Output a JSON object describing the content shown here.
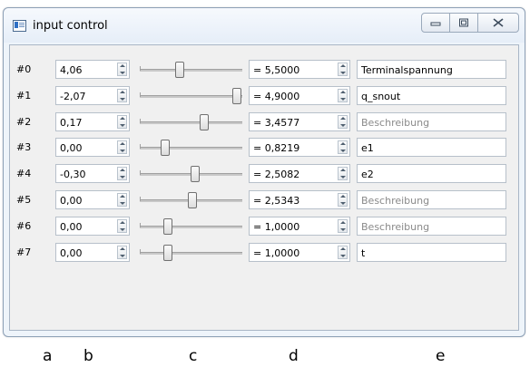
{
  "window": {
    "title": "input control"
  },
  "rows": [
    {
      "index": "#0",
      "number": "4,06",
      "slider_fraction": 0.38,
      "value": "= 5,5000",
      "description": "Terminalspannung",
      "placeholder": false
    },
    {
      "index": "#1",
      "number": "-2,07",
      "slider_fraction": 0.99,
      "value": "= 4,9000",
      "description": "q_snout",
      "placeholder": false
    },
    {
      "index": "#2",
      "number": "0,17",
      "slider_fraction": 0.64,
      "value": "= 3,4577",
      "description": "Beschreibung",
      "placeholder": true
    },
    {
      "index": "#3",
      "number": "0,00",
      "slider_fraction": 0.22,
      "value": "= 0,8219",
      "description": "e1",
      "placeholder": false
    },
    {
      "index": "#4",
      "number": "-0,30",
      "slider_fraction": 0.54,
      "value": "= 2,5082",
      "description": "e2",
      "placeholder": false
    },
    {
      "index": "#5",
      "number": "0,00",
      "slider_fraction": 0.51,
      "value": "= 2,5343",
      "description": "Beschreibung",
      "placeholder": true
    },
    {
      "index": "#6",
      "number": "0,00",
      "slider_fraction": 0.25,
      "value": "= 1,0000",
      "description": "Beschreibung",
      "placeholder": true
    },
    {
      "index": "#7",
      "number": "0,00",
      "slider_fraction": 0.25,
      "value": "= 1,0000",
      "description": "t",
      "placeholder": false
    }
  ],
  "column_labels": [
    "a",
    "b",
    "c",
    "d",
    "e"
  ]
}
